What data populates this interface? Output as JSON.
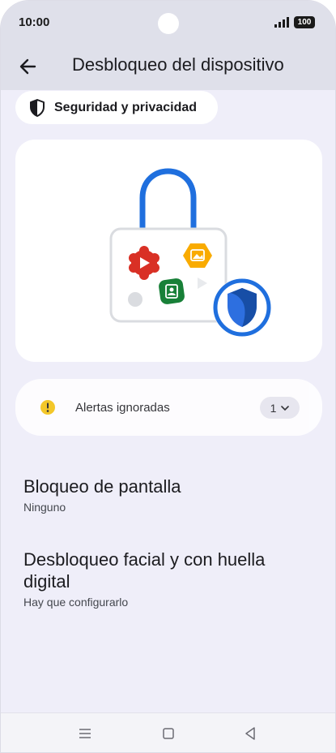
{
  "status": {
    "time": "10:00",
    "battery": "100"
  },
  "appbar": {
    "title": "Desbloqueo del dispositivo"
  },
  "chip": {
    "label": "Seguridad y privacidad"
  },
  "alerts": {
    "label": "Alertas ignoradas",
    "count": "1"
  },
  "settings": [
    {
      "title": "Bloqueo de pantalla",
      "subtitle": "Ninguno"
    },
    {
      "title": "Desbloqueo facial y con huella digital",
      "subtitle": "Hay que configurarlo"
    }
  ],
  "colors": {
    "background": "#efeef9",
    "lock_blue": "#1f6fde",
    "shield_blue": "#2d6fe0",
    "warning_yellow": "#f4c20d"
  }
}
